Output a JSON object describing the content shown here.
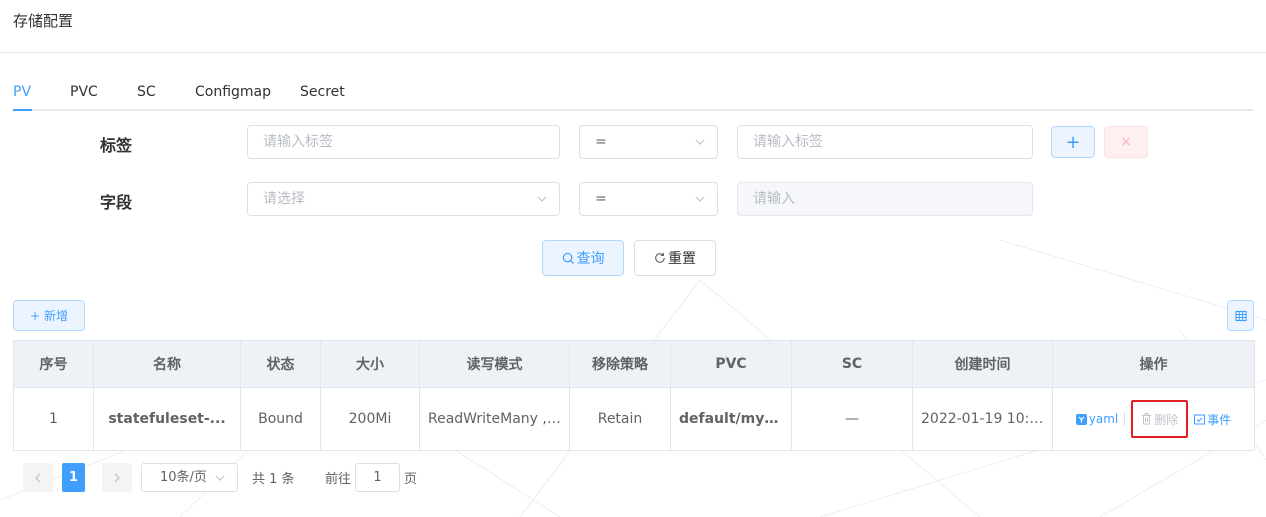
{
  "page": {
    "title": "存储配置"
  },
  "tabs": [
    {
      "label": "PV",
      "active": true
    },
    {
      "label": "PVC",
      "active": false
    },
    {
      "label": "SC",
      "active": false
    },
    {
      "label": "Configmap",
      "active": false
    },
    {
      "label": "Secret",
      "active": false
    }
  ],
  "filters": {
    "label_row": {
      "label": "标签",
      "key_placeholder": "请输入标签",
      "operator": "=",
      "value_placeholder": "请输入标签",
      "add_symbol": "+",
      "remove_symbol": "×"
    },
    "field_row": {
      "label": "字段",
      "key_placeholder": "请选择",
      "operator": "=",
      "value_placeholder": "请输入"
    },
    "query_label": "查询",
    "reset_label": "重置"
  },
  "toolbar": {
    "add_label": "新增",
    "add_symbol": "+"
  },
  "table": {
    "columns": [
      "序号",
      "名称",
      "状态",
      "大小",
      "读写模式",
      "移除策略",
      "PVC",
      "SC",
      "创建时间",
      "操作"
    ],
    "rows": [
      {
        "index": "1",
        "name": "statefuleset-...",
        "status": "Bound",
        "size": "200Mi",
        "access_mode": "ReadWriteMany , ...",
        "reclaim_policy": "Retain",
        "pvc": "default/myp...",
        "sc": "—",
        "created": "2022-01-19 10:0...",
        "actions": {
          "yaml": "yaml",
          "delete": "删除",
          "events": "事件"
        }
      }
    ]
  },
  "pagination": {
    "current_page": "1",
    "page_size": "10条/页",
    "total_text": "共 1 条",
    "goto_prefix": "前往",
    "goto_value": "1",
    "goto_suffix": "页"
  },
  "colors": {
    "primary": "#409eff",
    "danger_outline": "#e02020",
    "header_bg": "#eef1f6"
  },
  "icons": [
    "plus-icon",
    "close-icon",
    "search-icon",
    "refresh-icon",
    "columns-icon",
    "yaml-icon",
    "trash-icon",
    "event-icon",
    "chevron-down-icon",
    "chevron-left-icon",
    "chevron-right-icon"
  ]
}
